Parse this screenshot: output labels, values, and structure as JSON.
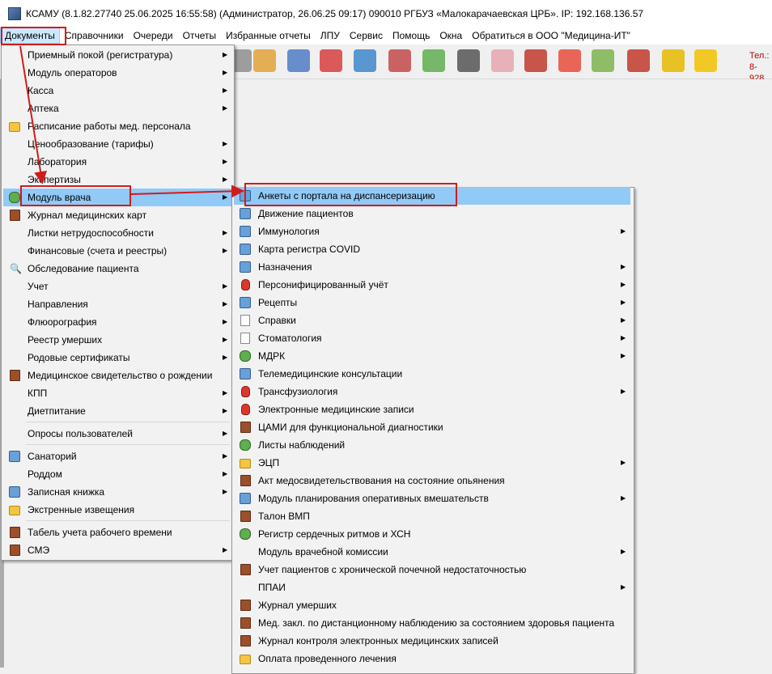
{
  "window": {
    "title": "КСАМУ (8.1.82.27740 25.06.2025 16:55:58) (Администратор, 26.06.25 09:17)  090010 РГБУЗ «Малокарачаевская ЦРБ». IP: 192.168.136.57"
  },
  "menubar": [
    "Документы",
    "Справочники",
    "Очереди",
    "Отчеты",
    "Избранные отчеты",
    "ЛПУ",
    "Сервис",
    "Помощь",
    "Окна",
    "Обратиться в ООО \"Медицина-ИТ\""
  ],
  "toolbar": {
    "tel_line1": "Тел.:",
    "tel_line2": "8-928",
    "icons": [
      "phone-icon",
      "address-book-icon",
      "pills-icon",
      "medical-kit-icon",
      "globe-book-icon",
      "thermometer-icon",
      "capsules-icon",
      "barcode-scanner-icon",
      "nurse-icon",
      "red-book-icon",
      "report-icon",
      "schedule-icon",
      "red-letter-icon",
      "lock-icon",
      "chat-bubble-icon"
    ]
  },
  "documents_menu": [
    {
      "label": "Приемный покой (регистратура)",
      "submenu": true,
      "icon": ""
    },
    {
      "label": "Модуль операторов",
      "submenu": true,
      "icon": ""
    },
    {
      "label": "Касса",
      "submenu": true,
      "icon": ""
    },
    {
      "label": "Аптека",
      "submenu": true,
      "icon": ""
    },
    {
      "label": "Расписание работы мед. персонала",
      "submenu": false,
      "icon": "schedule-icon"
    },
    {
      "label": "Ценообразование (тарифы)",
      "submenu": true,
      "icon": ""
    },
    {
      "label": "Лаборатория",
      "submenu": true,
      "icon": ""
    },
    {
      "label": "Экспертизы",
      "submenu": true,
      "icon": ""
    },
    {
      "label": "Модуль врача",
      "submenu": true,
      "icon": "doctor-icon"
    },
    {
      "label": "Журнал медицинских карт",
      "submenu": false,
      "icon": "book-icon"
    },
    {
      "label": "Листки нетрудоспособности",
      "submenu": true,
      "icon": ""
    },
    {
      "label": "Финансовые (счета и реестры)",
      "submenu": true,
      "icon": ""
    },
    {
      "label": "Обследование пациента",
      "submenu": false,
      "icon": "magnifier-icon"
    },
    {
      "label": "Учет",
      "submenu": true,
      "icon": ""
    },
    {
      "label": "Направления",
      "submenu": true,
      "icon": ""
    },
    {
      "label": "Флюорография",
      "submenu": true,
      "icon": ""
    },
    {
      "label": "Реестр умерших",
      "submenu": true,
      "icon": ""
    },
    {
      "label": "Родовые сертификаты",
      "submenu": true,
      "icon": ""
    },
    {
      "label": "Медицинское свидетельство о рождении",
      "submenu": false,
      "icon": "book-icon"
    },
    {
      "label": "КПП",
      "submenu": true,
      "icon": ""
    },
    {
      "label": "Диетпитание",
      "submenu": true,
      "icon": ""
    },
    {
      "label": "Опросы пользователей",
      "submenu": true,
      "icon": ""
    },
    {
      "label": "Санаторий",
      "submenu": true,
      "icon": "sanatorium-icon"
    },
    {
      "label": "Роддом",
      "submenu": true,
      "icon": ""
    },
    {
      "label": "Записная книжка",
      "submenu": true,
      "icon": "notebook-icon"
    },
    {
      "label": "Экстренные извещения",
      "submenu": false,
      "icon": "envelope-icon"
    },
    {
      "label": "Табель учета рабочего времени",
      "submenu": false,
      "icon": "book-icon"
    },
    {
      "label": "СМЭ",
      "submenu": true,
      "icon": "book-icon"
    }
  ],
  "doctor_module_menu": [
    {
      "label": "Анкеты с портала на диспансеризацию",
      "submenu": false,
      "icon": "form-icon"
    },
    {
      "label": "Движение пациентов",
      "submenu": false,
      "icon": "patients-icon"
    },
    {
      "label": "Иммунология",
      "submenu": true,
      "icon": "syringe-icon"
    },
    {
      "label": "Карта регистра COVID",
      "submenu": false,
      "icon": "covid-card-icon"
    },
    {
      "label": "Назначения",
      "submenu": true,
      "icon": "prescription-icon"
    },
    {
      "label": "Персонифицированный учёт",
      "submenu": true,
      "icon": "medical-record-icon"
    },
    {
      "label": "Рецепты",
      "submenu": true,
      "icon": "recipe-icon"
    },
    {
      "label": "Справки",
      "submenu": true,
      "icon": "certificate-icon"
    },
    {
      "label": "Стоматология",
      "submenu": true,
      "icon": "tooth-icon"
    },
    {
      "label": "МДРК",
      "submenu": true,
      "icon": "team-icon"
    },
    {
      "label": "Телемедицинские консультации",
      "submenu": false,
      "icon": "telemedicine-icon"
    },
    {
      "label": "Трансфузиология",
      "submenu": true,
      "icon": "blood-drop-icon"
    },
    {
      "label": "Электронные медицинские записи",
      "submenu": false,
      "icon": "electronic-record-icon"
    },
    {
      "label": "ЦАМИ для функциональной диагностики",
      "submenu": false,
      "icon": "book-icon"
    },
    {
      "label": "Листы наблюдений",
      "submenu": false,
      "icon": "observation-sheet-icon"
    },
    {
      "label": "ЭЦП",
      "submenu": true,
      "icon": "signature-icon"
    },
    {
      "label": "Акт медосвидетельствования на состояние опьянения",
      "submenu": false,
      "icon": "book-icon"
    },
    {
      "label": "Модуль планирования оперативных вмешательств",
      "submenu": true,
      "icon": "surgeon-icon"
    },
    {
      "label": "Талон ВМП",
      "submenu": false,
      "icon": "book-icon"
    },
    {
      "label": "Регистр сердечных ритмов и ХСН",
      "submenu": false,
      "icon": "heart-rhythm-icon"
    },
    {
      "label": "Модуль врачебной комиссии",
      "submenu": true,
      "icon": ""
    },
    {
      "label": "Учет пациентов с хронической почечной недостаточностью",
      "submenu": false,
      "icon": "book-icon"
    },
    {
      "label": "ППАИ",
      "submenu": true,
      "icon": ""
    },
    {
      "label": "Журнал умерших",
      "submenu": false,
      "icon": "book-icon"
    },
    {
      "label": "Мед. закл. по дистанционному наблюдению за состоянием здоровья пациента",
      "submenu": false,
      "icon": "book-icon"
    },
    {
      "label": "Журнал контроля электронных медицинских записей",
      "submenu": false,
      "icon": "book-icon"
    },
    {
      "label": "Оплата проведенного лечения",
      "submenu": false,
      "icon": "payment-icon"
    }
  ]
}
